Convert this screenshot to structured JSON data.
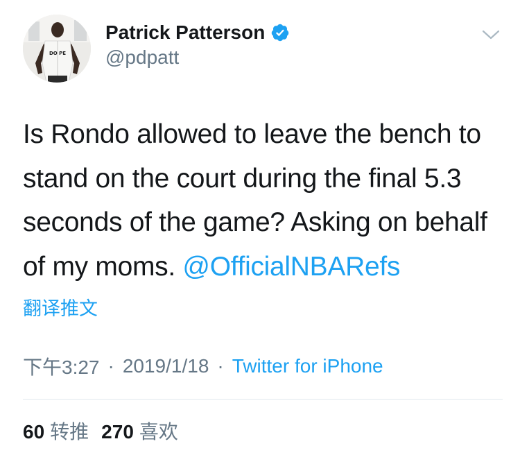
{
  "author": {
    "display_name": "Patrick Patterson",
    "handle": "@pdpatt",
    "verified": true,
    "avatar_shirt_text": "DO PE"
  },
  "tweet": {
    "text": "Is Rondo allowed to leave the bench to stand on the court during the final 5.3 seconds of the game? Asking on behalf of my moms. ",
    "mention": "@OfficialNBARefs",
    "translate_label": "翻译推文"
  },
  "meta": {
    "time": "下午3:27",
    "separator": "·",
    "date": "2019/1/18",
    "source": "Twitter for iPhone"
  },
  "stats": {
    "retweets_count": "60",
    "retweets_label": "转推",
    "likes_count": "270",
    "likes_label": "喜欢"
  },
  "colors": {
    "link": "#1da1f2",
    "secondary_text": "#657786",
    "primary_text": "#14171a",
    "divider": "#e1e8ed"
  },
  "icons": {
    "verified": "verified-badge-icon",
    "menu": "chevron-down-icon"
  }
}
